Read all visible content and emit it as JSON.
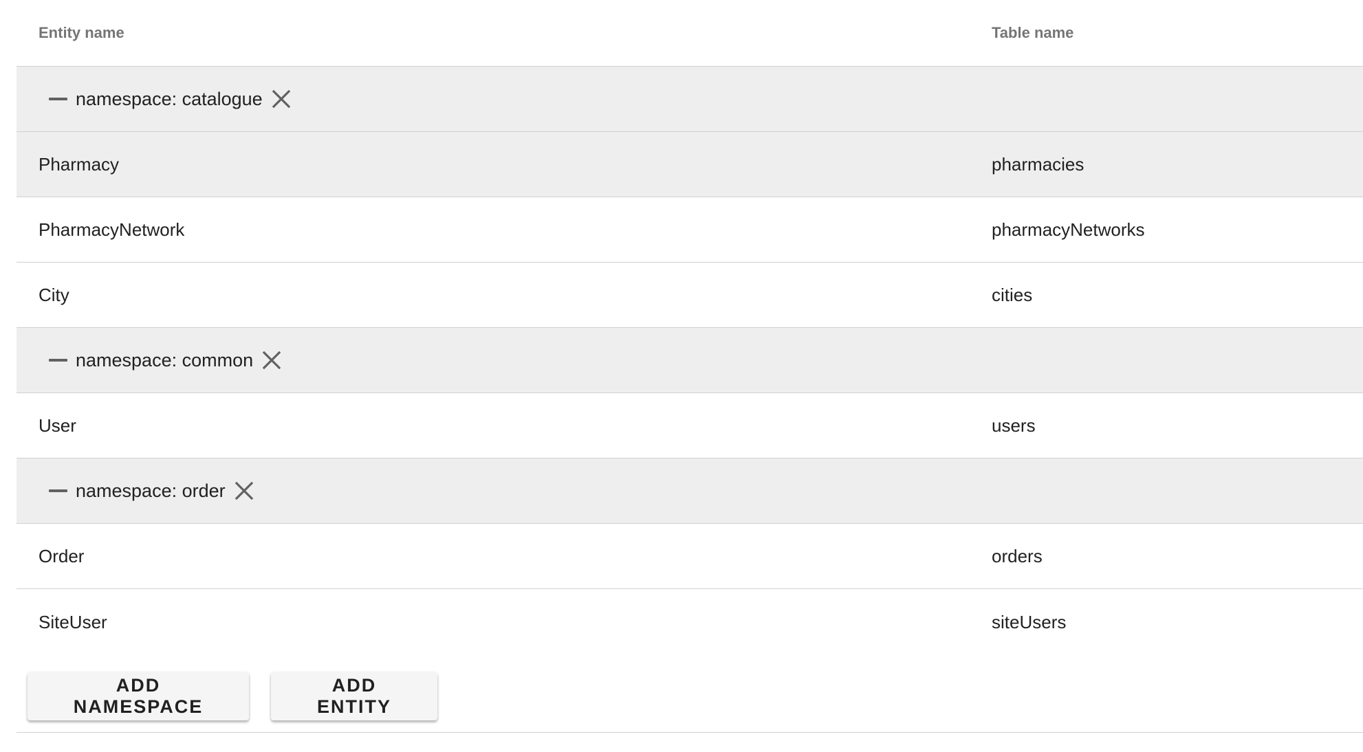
{
  "table": {
    "headers": {
      "entity_name": "Entity name",
      "table_name": "Table name"
    },
    "groups": [
      {
        "label": "namespace: catalogue",
        "rows": [
          {
            "entity": "Pharmacy",
            "table": "pharmacies",
            "selected": true
          },
          {
            "entity": "PharmacyNetwork",
            "table": "pharmacyNetworks",
            "selected": false
          },
          {
            "entity": "City",
            "table": "cities",
            "selected": false
          }
        ]
      },
      {
        "label": "namespace: common",
        "rows": [
          {
            "entity": "User",
            "table": "users",
            "selected": false
          }
        ]
      },
      {
        "label": "namespace: order",
        "rows": [
          {
            "entity": "Order",
            "table": "orders",
            "selected": false
          },
          {
            "entity": "SiteUser",
            "table": "siteUsers",
            "selected": false
          }
        ]
      }
    ]
  },
  "actions": {
    "add_namespace_label": "ADD NAMESPACE",
    "add_entity_label": "ADD ENTITY"
  },
  "icons": {
    "collapse": "minus-icon",
    "remove": "close-icon"
  },
  "colors": {
    "group_background": "#eeeeee",
    "header_text": "#757575",
    "icon": "#616161"
  }
}
